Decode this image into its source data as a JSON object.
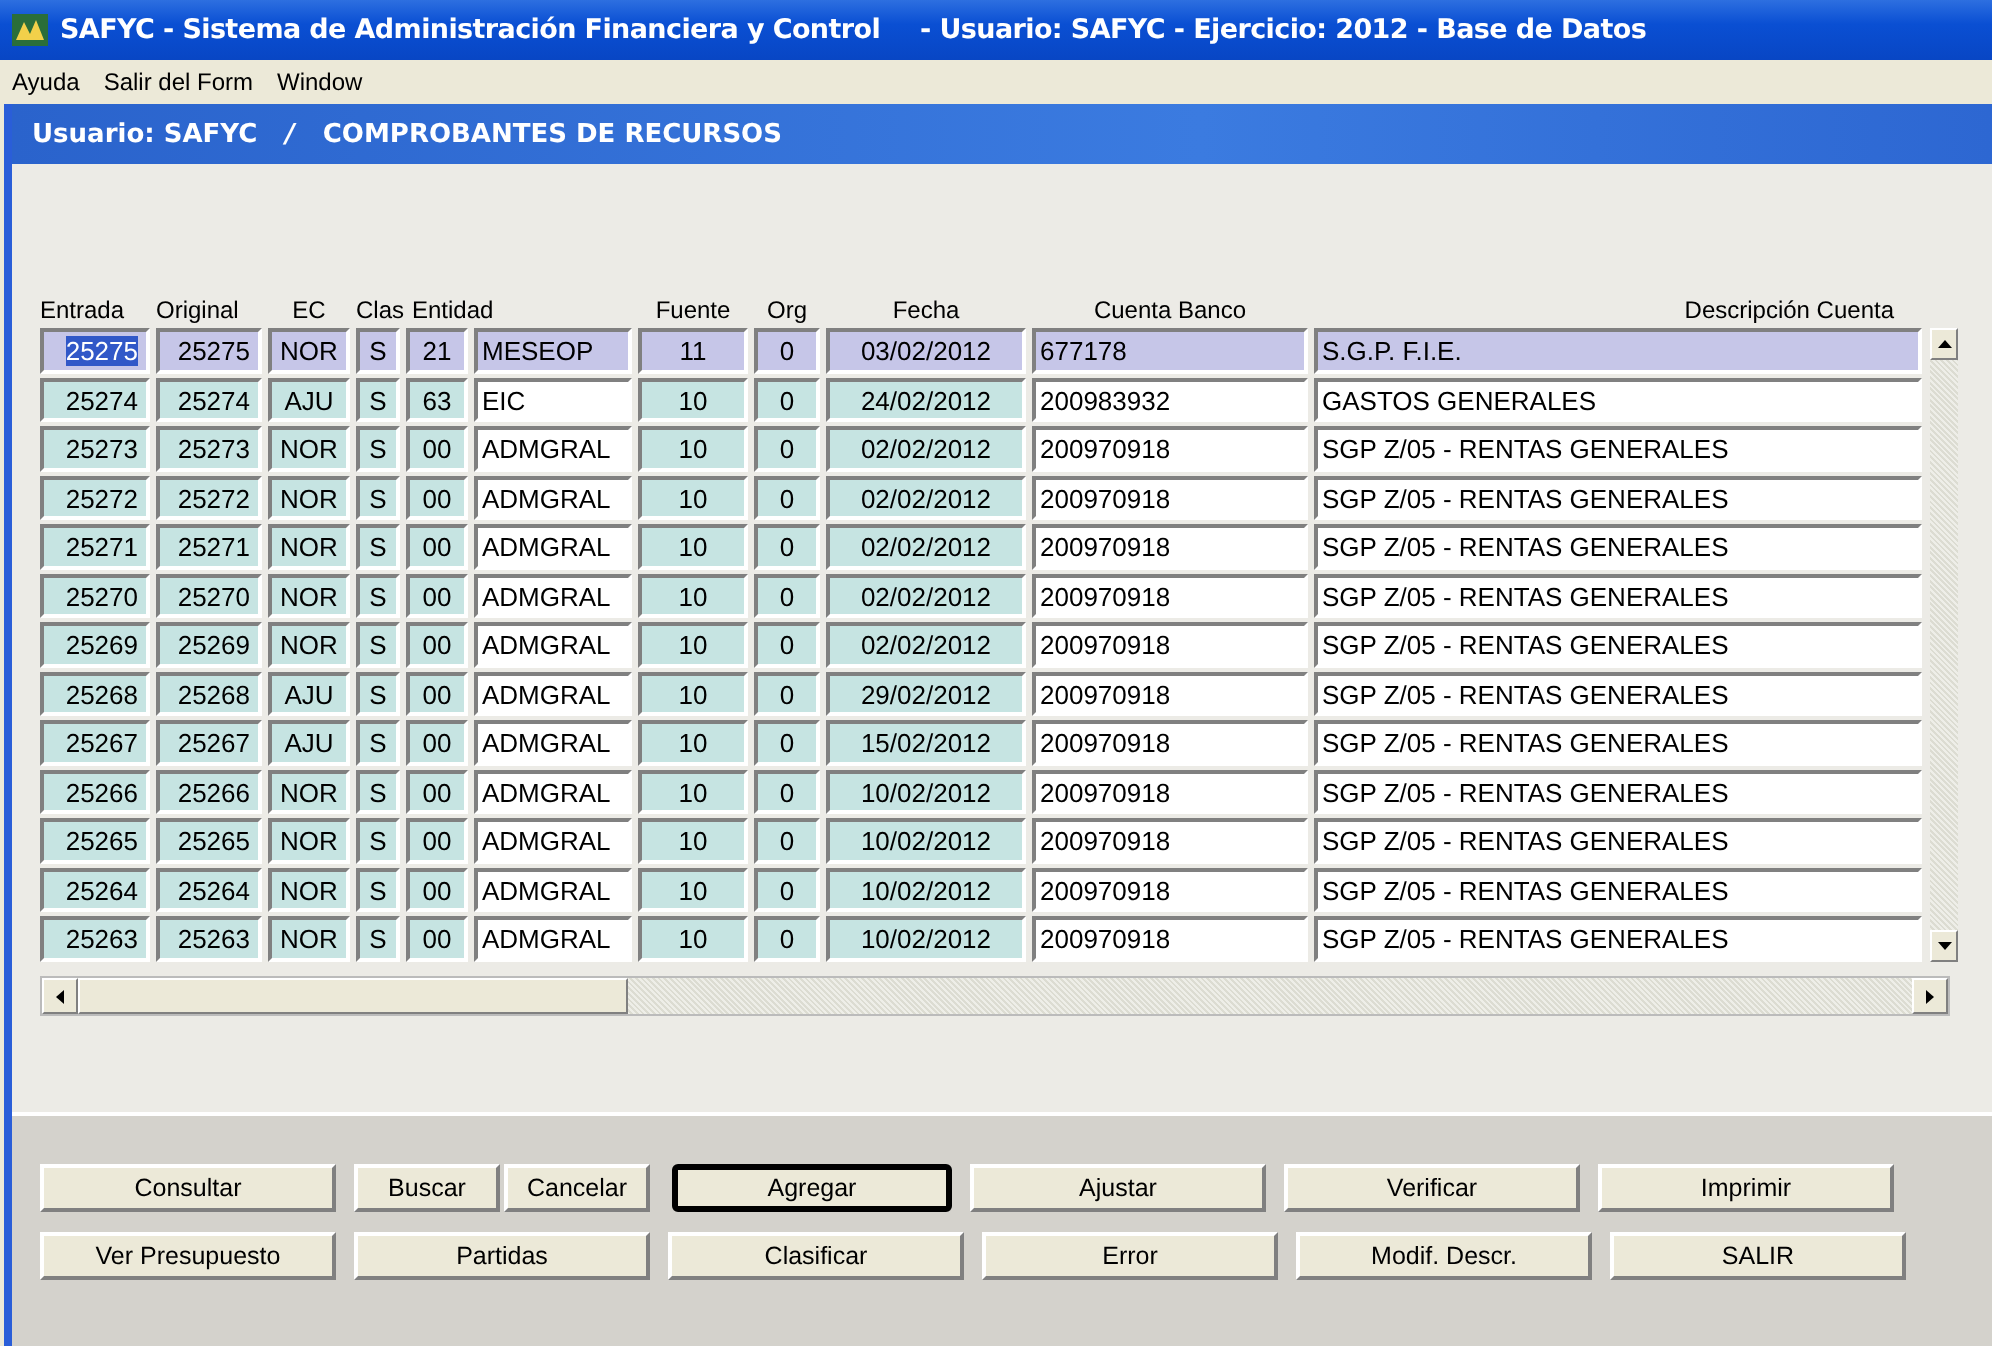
{
  "window": {
    "title": "SAFYC - Sistema de Administración Financiera y Control",
    "subtitle": "- Usuario: SAFYC - Ejercicio: 2012 - Base de Datos"
  },
  "menu": [
    "Ayuda",
    "Salir del Form",
    "Window"
  ],
  "form": {
    "user": "Usuario: SAFYC",
    "separator": "/",
    "title": "COMPROBANTES DE RECURSOS"
  },
  "table": {
    "columns": [
      "Entrada",
      "Original",
      "EC",
      "Clas",
      "Entidad",
      "Fuente",
      "Org",
      "Fecha",
      "Cuenta Banco",
      "Descripción Cuenta"
    ],
    "rows": [
      {
        "selected": true,
        "cells": [
          "25275",
          "25275",
          "NOR",
          "S",
          {
            "code": "21",
            "name": "MESEOP"
          },
          "11",
          "0",
          "03/02/2012",
          "677178",
          "S.G.P. F.I.E."
        ]
      },
      {
        "selected": false,
        "cells": [
          "25274",
          "25274",
          "AJU",
          "S",
          {
            "code": "63",
            "name": "EIC"
          },
          "10",
          "0",
          "24/02/2012",
          "200983932",
          "GASTOS GENERALES"
        ]
      },
      {
        "selected": false,
        "cells": [
          "25273",
          "25273",
          "NOR",
          "S",
          {
            "code": "00",
            "name": "ADMGRAL"
          },
          "10",
          "0",
          "02/02/2012",
          "200970918",
          "SGP Z/05 - RENTAS GENERALES"
        ]
      },
      {
        "selected": false,
        "cells": [
          "25272",
          "25272",
          "NOR",
          "S",
          {
            "code": "00",
            "name": "ADMGRAL"
          },
          "10",
          "0",
          "02/02/2012",
          "200970918",
          "SGP Z/05 - RENTAS GENERALES"
        ]
      },
      {
        "selected": false,
        "cells": [
          "25271",
          "25271",
          "NOR",
          "S",
          {
            "code": "00",
            "name": "ADMGRAL"
          },
          "10",
          "0",
          "02/02/2012",
          "200970918",
          "SGP Z/05 - RENTAS GENERALES"
        ]
      },
      {
        "selected": false,
        "cells": [
          "25270",
          "25270",
          "NOR",
          "S",
          {
            "code": "00",
            "name": "ADMGRAL"
          },
          "10",
          "0",
          "02/02/2012",
          "200970918",
          "SGP Z/05 - RENTAS GENERALES"
        ]
      },
      {
        "selected": false,
        "cells": [
          "25269",
          "25269",
          "NOR",
          "S",
          {
            "code": "00",
            "name": "ADMGRAL"
          },
          "10",
          "0",
          "02/02/2012",
          "200970918",
          "SGP Z/05 - RENTAS GENERALES"
        ]
      },
      {
        "selected": false,
        "cells": [
          "25268",
          "25268",
          "AJU",
          "S",
          {
            "code": "00",
            "name": "ADMGRAL"
          },
          "10",
          "0",
          "29/02/2012",
          "200970918",
          "SGP Z/05 - RENTAS GENERALES"
        ]
      },
      {
        "selected": false,
        "cells": [
          "25267",
          "25267",
          "AJU",
          "S",
          {
            "code": "00",
            "name": "ADMGRAL"
          },
          "10",
          "0",
          "15/02/2012",
          "200970918",
          "SGP Z/05 - RENTAS GENERALES"
        ]
      },
      {
        "selected": false,
        "cells": [
          "25266",
          "25266",
          "NOR",
          "S",
          {
            "code": "00",
            "name": "ADMGRAL"
          },
          "10",
          "0",
          "10/02/2012",
          "200970918",
          "SGP Z/05 - RENTAS GENERALES"
        ]
      },
      {
        "selected": false,
        "cells": [
          "25265",
          "25265",
          "NOR",
          "S",
          {
            "code": "00",
            "name": "ADMGRAL"
          },
          "10",
          "0",
          "10/02/2012",
          "200970918",
          "SGP Z/05 - RENTAS GENERALES"
        ]
      },
      {
        "selected": false,
        "cells": [
          "25264",
          "25264",
          "NOR",
          "S",
          {
            "code": "00",
            "name": "ADMGRAL"
          },
          "10",
          "0",
          "10/02/2012",
          "200970918",
          "SGP Z/05 - RENTAS GENERALES"
        ]
      },
      {
        "selected": false,
        "cells": [
          "25263",
          "25263",
          "NOR",
          "S",
          {
            "code": "00",
            "name": "ADMGRAL"
          },
          "10",
          "0",
          "10/02/2012",
          "200970918",
          "SGP Z/05 - RENTAS GENERALES"
        ]
      }
    ]
  },
  "buttons": [
    [
      {
        "label": "Consultar",
        "focused": false
      },
      {
        "label": "Buscar",
        "focused": false
      },
      {
        "label": "Cancelar",
        "focused": false
      },
      {
        "label": "Agregar",
        "focused": true
      },
      {
        "label": "Ajustar",
        "focused": false
      },
      {
        "label": "Verificar",
        "focused": false
      },
      {
        "label": "Imprimir",
        "focused": false
      }
    ],
    [
      {
        "label": "Ver Presupuesto",
        "focused": false
      },
      {
        "label": "Partidas",
        "focused": false
      },
      {
        "label": "Clasificar",
        "focused": false
      },
      {
        "label": "Error",
        "focused": false
      },
      {
        "label": "Modif. Descr.",
        "focused": false
      },
      {
        "label": "SALIR",
        "focused": false
      }
    ]
  ]
}
